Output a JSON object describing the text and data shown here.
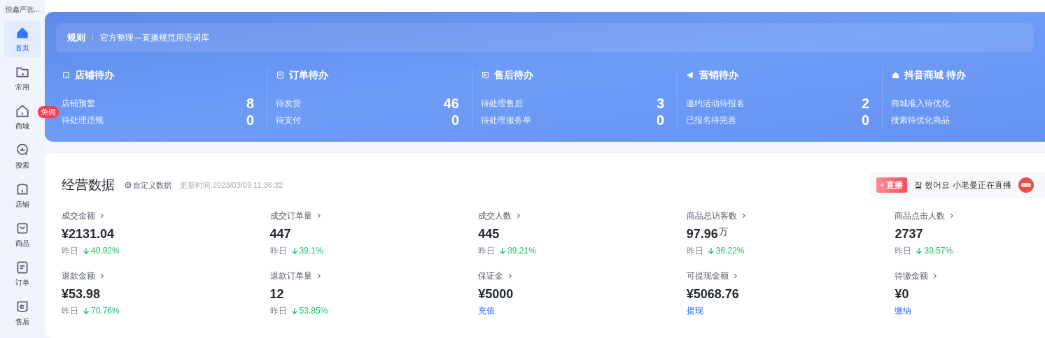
{
  "sidebar": {
    "store_name": "悦鑫严选...",
    "items": [
      {
        "label": "首页",
        "selected": true,
        "kind": "home"
      },
      {
        "label": "常用",
        "selected": false,
        "kind": "folder"
      },
      {
        "label": "商城",
        "selected": false,
        "kind": "mall",
        "badge": "免佣"
      },
      {
        "label": "搜索",
        "selected": false,
        "kind": "search"
      },
      {
        "label": "店铺",
        "selected": false,
        "kind": "shop"
      },
      {
        "label": "商品",
        "selected": false,
        "kind": "bag"
      },
      {
        "label": "订单",
        "selected": false,
        "kind": "order"
      },
      {
        "label": "售后",
        "selected": false,
        "kind": "aftersale"
      }
    ]
  },
  "notice": {
    "tag": "规则",
    "text": "官方整理—直播规范用语词库"
  },
  "todos": [
    {
      "title": "店铺待办",
      "kind": "shop",
      "rows": [
        {
          "label": "店铺预警",
          "count": "8"
        },
        {
          "label": "待处理违规",
          "count": "0"
        }
      ]
    },
    {
      "title": "订单待办",
      "kind": "order",
      "rows": [
        {
          "label": "待发货",
          "count": "46"
        },
        {
          "label": "待支付",
          "count": "0"
        }
      ]
    },
    {
      "title": "售后待办",
      "kind": "aftersale",
      "rows": [
        {
          "label": "待处理售后",
          "count": "3"
        },
        {
          "label": "待处理服务单",
          "count": "0"
        }
      ]
    },
    {
      "title": "营销待办",
      "kind": "megaphone",
      "rows": [
        {
          "label": "邀约活动待报名",
          "count": "2"
        },
        {
          "label": "已报名待完善",
          "count": "0"
        }
      ]
    },
    {
      "title": "抖音商城 待办",
      "kind": "home",
      "rows": [
        {
          "label": "商城准入待优化"
        },
        {
          "label": "搜索待优化商品"
        }
      ]
    }
  ],
  "business": {
    "title": "经营数据",
    "custom_link": "自定义数据",
    "updated": "更新时间:2023/03/09 11:36:32",
    "live": {
      "badge": "直播",
      "text": "잘 했어요 小老曼正在直播"
    },
    "metrics": [
      {
        "label": "成交金额",
        "value": "¥2131.04",
        "footer": {
          "kind": "compare",
          "prefix": "昨日",
          "change": "40.92%"
        }
      },
      {
        "label": "成交订单量",
        "value": "447",
        "footer": {
          "kind": "compare",
          "prefix": "昨日",
          "change": "39.1%"
        }
      },
      {
        "label": "成交人数",
        "value": "445",
        "footer": {
          "kind": "compare",
          "prefix": "昨日",
          "change": "39.21%"
        }
      },
      {
        "label": "商品总访客数",
        "value": "97.96",
        "unit": "万",
        "footer": {
          "kind": "compare",
          "prefix": "昨日",
          "change": "36.22%"
        }
      },
      {
        "label": "商品点击人数",
        "value": "2737",
        "footer": {
          "kind": "compare",
          "prefix": "昨日",
          "change": "39.57%"
        }
      },
      {
        "label": "退款金额",
        "value": "¥53.98",
        "footer": {
          "kind": "compare",
          "prefix": "昨日",
          "change": "70.76%"
        }
      },
      {
        "label": "退款订单量",
        "value": "12",
        "footer": {
          "kind": "compare",
          "prefix": "昨日",
          "change": "53.85%"
        }
      },
      {
        "label": "保证金",
        "value": "¥5000",
        "footer": {
          "kind": "link",
          "text": "充值"
        }
      },
      {
        "label": "可提现金额",
        "value": "¥5068.76",
        "footer": {
          "kind": "link",
          "text": "提现"
        }
      },
      {
        "label": "待缴金额",
        "value": "¥0",
        "footer": {
          "kind": "link",
          "text": "缴纳"
        }
      }
    ]
  }
}
